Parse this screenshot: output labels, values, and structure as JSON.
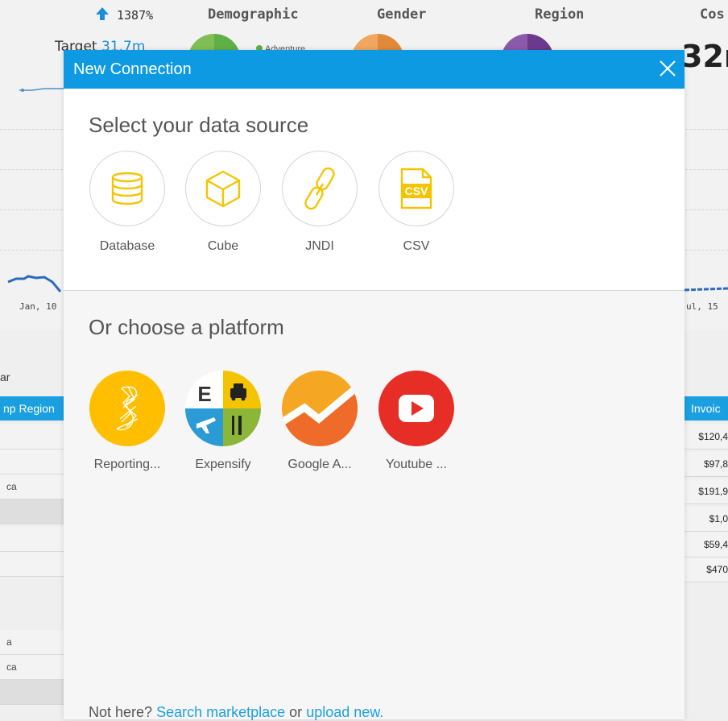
{
  "background": {
    "kpi_change": "1387%",
    "headers": [
      "Demographic",
      "Gender",
      "Region",
      "Cos"
    ],
    "target_label": "Target",
    "target_value": "31.7m",
    "legend_item": "Adventure",
    "cost_value": "32r",
    "x_axis_left": "Jan, 10",
    "x_axis_right": "ul, 15",
    "side_label": "ar",
    "left_column_header": "np Region",
    "left_rows": [
      "",
      "",
      "ca",
      "",
      "",
      "",
      "a",
      "ca",
      ""
    ],
    "right_column_header": "Invoic",
    "right_values": [
      "$120,4",
      "$97,8",
      "$191,9",
      "$1,0",
      "$59,4",
      "$470"
    ]
  },
  "modal": {
    "title": "New Connection",
    "close_icon": "close-icon",
    "data_source_title": "Select your data source",
    "data_sources": [
      {
        "label": "Database",
        "icon": "database-icon"
      },
      {
        "label": "Cube",
        "icon": "cube-icon"
      },
      {
        "label": "JNDI",
        "icon": "chain-link-icon"
      },
      {
        "label": "CSV",
        "icon": "csv-file-icon",
        "badge": "CSV"
      }
    ],
    "platform_title": "Or choose a platform",
    "platforms": [
      {
        "label": "Reporting...",
        "icon": "reporting-services-icon"
      },
      {
        "label": "Expensify",
        "icon": "expensify-icon",
        "letter": "E"
      },
      {
        "label": "Google A...",
        "icon": "google-analytics-icon"
      },
      {
        "label": "Youtube ...",
        "icon": "youtube-icon"
      }
    ],
    "footer": {
      "prefix": "Not here?",
      "marketplace_link": "Search marketplace",
      "middle": "or",
      "upload_link": "upload new."
    }
  },
  "colors": {
    "header_blue": "#0d9ae3",
    "icon_yellow": "#f5c400",
    "link_blue": "#1a9fe0",
    "reporting_yellow": "#ffbf00",
    "google_orange": "#f5a623",
    "youtube_red": "#e62d26"
  }
}
